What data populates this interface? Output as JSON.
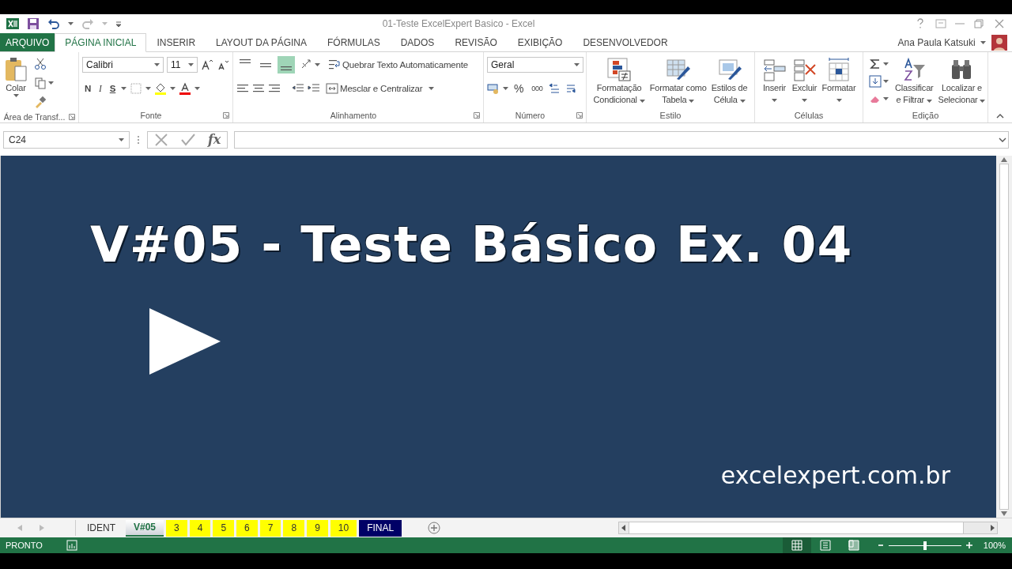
{
  "window": {
    "title": "01-Teste ExcelExpert Basico - Excel"
  },
  "ribbon_tabs": [
    {
      "label": "ARQUIVO",
      "kind": "file",
      "selected": false
    },
    {
      "label": "PÁGINA INICIAL",
      "kind": "tab",
      "selected": true
    },
    {
      "label": "INSERIR",
      "kind": "tab",
      "selected": false
    },
    {
      "label": "LAYOUT DA PÁGINA",
      "kind": "tab",
      "selected": false
    },
    {
      "label": "FÓRMULAS",
      "kind": "tab",
      "selected": false
    },
    {
      "label": "DADOS",
      "kind": "tab",
      "selected": false
    },
    {
      "label": "REVISÃO",
      "kind": "tab",
      "selected": false
    },
    {
      "label": "EXIBIÇÃO",
      "kind": "tab",
      "selected": false
    },
    {
      "label": "DESENVOLVEDOR",
      "kind": "tab",
      "selected": false
    }
  ],
  "user": {
    "name": "Ana Paula Katsuki"
  },
  "clipboard": {
    "paste": "Colar",
    "group": "Área de Transf..."
  },
  "font": {
    "name": "Calibri",
    "size": "11",
    "bold": "N",
    "italic": "I",
    "underline": "S",
    "group": "Fonte"
  },
  "alignment": {
    "vertical": [
      {
        "selected": false
      },
      {
        "selected": false
      },
      {
        "selected": true
      }
    ],
    "wrap": "Quebrar Texto Automaticamente",
    "merge": "Mesclar e Centralizar",
    "group": "Alinhamento"
  },
  "number": {
    "format": "Geral",
    "percent": "%",
    "thousands": "000",
    "group": "Número"
  },
  "styles": {
    "group": "Estilo",
    "buttons": [
      {
        "kind": "conditional",
        "lines": [
          "Formatação",
          "Condicional"
        ]
      },
      {
        "kind": "table",
        "lines": [
          "Formatar como",
          "Tabela"
        ]
      },
      {
        "kind": "cellstyle",
        "lines": [
          "Estilos de",
          "Célula"
        ]
      }
    ]
  },
  "cells": {
    "group": "Células",
    "buttons": [
      {
        "kind": "insert",
        "lines": [
          "Inserir"
        ]
      },
      {
        "kind": "delete",
        "lines": [
          "Excluir"
        ]
      },
      {
        "kind": "format",
        "lines": [
          "Formatar"
        ]
      }
    ]
  },
  "editing": {
    "group": "Edição",
    "buttons": [
      {
        "kind": "sort",
        "lines": [
          "Classificar",
          "e Filtrar"
        ]
      },
      {
        "kind": "find",
        "lines": [
          "Localizar e",
          "Selecionar"
        ]
      }
    ]
  },
  "formula_bar": {
    "name_box": "C24",
    "fx": "fx"
  },
  "slide": {
    "title": "V#05 - Teste Básico Ex. 04",
    "url": "excelexpert.com.br"
  },
  "sheet_tabs": [
    {
      "label": "IDENT",
      "selected": false
    },
    {
      "label": "V#05",
      "selected": true
    },
    {
      "label": "3",
      "selected": false,
      "color": "#ffff00"
    },
    {
      "label": "4",
      "selected": false,
      "color": "#ffff00"
    },
    {
      "label": "5",
      "selected": false,
      "color": "#ffff00"
    },
    {
      "label": "6",
      "selected": false,
      "color": "#ffff00"
    },
    {
      "label": "7",
      "selected": false,
      "color": "#ffff00"
    },
    {
      "label": "8",
      "selected": false,
      "color": "#ffff00"
    },
    {
      "label": "9",
      "selected": false,
      "color": "#ffff00"
    },
    {
      "label": "10",
      "selected": false,
      "color": "#ffff00"
    },
    {
      "label": "FINAL",
      "selected": false,
      "color": "#000066"
    }
  ],
  "status_bar": {
    "status": "PRONTO",
    "views": [
      {
        "selected": true
      },
      {
        "selected": false
      },
      {
        "selected": false
      }
    ],
    "zoom": {
      "level": 0.5,
      "reading": "100%"
    }
  }
}
